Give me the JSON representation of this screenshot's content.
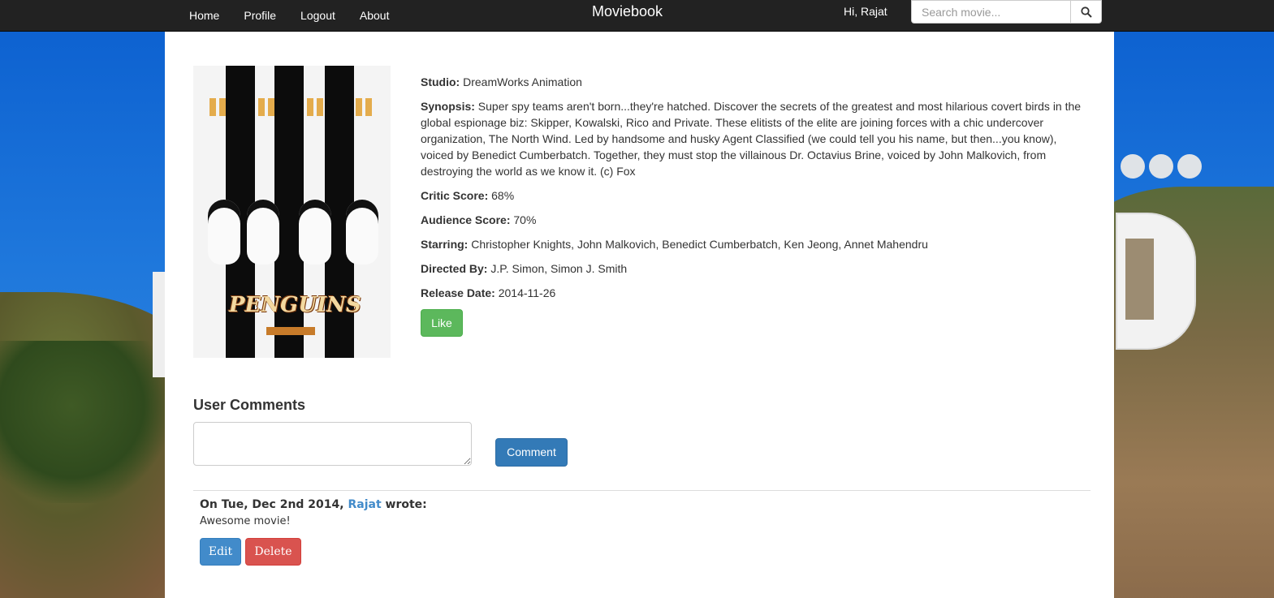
{
  "nav": {
    "links": [
      "Home",
      "Profile",
      "Logout",
      "About"
    ],
    "brand": "Moviebook",
    "greeting": "Hi, Rajat",
    "search_placeholder": "Search movie..."
  },
  "movie": {
    "poster_title": "PENGUINS",
    "studio_label": "Studio:",
    "studio": "DreamWorks Animation",
    "synopsis_label": "Synopsis:",
    "synopsis": "Super spy teams aren't born...they're hatched. Discover the secrets of the greatest and most hilarious covert birds in the global espionage biz: Skipper, Kowalski, Rico and Private. These elitists of the elite are joining forces with a chic undercover organization, The North Wind. Led by handsome and husky Agent Classified (we could tell you his name, but then...you know), voiced by Benedict Cumberbatch. Together, they must stop the villainous Dr. Octavius Brine, voiced by John Malkovich, from destroying the world as we know it. (c) Fox",
    "critic_label": "Critic Score:",
    "critic_score": "68%",
    "audience_label": "Audience Score:",
    "audience_score": "70%",
    "starring_label": "Starring:",
    "starring": "Christopher Knights, John Malkovich, Benedict Cumberbatch, Ken Jeong, Annet Mahendru",
    "directed_label": "Directed By:",
    "directed": "J.P. Simon, Simon J. Smith",
    "release_label": "Release Date:",
    "release_date": "2014-11-26",
    "like_label": "Like"
  },
  "comments": {
    "heading": "User Comments",
    "comment_button": "Comment",
    "items": [
      {
        "prefix": "On Tue, Dec 2nd 2014,",
        "author": "Rajat",
        "suffix": "wrote:",
        "text": "Awesome movie!",
        "edit_label": "Edit",
        "delete_label": "Delete"
      }
    ]
  },
  "colors": {
    "navbar": "#222222",
    "like": "#5cb85c",
    "comment": "#337ab7",
    "edit": "#428bca",
    "delete": "#d9534f"
  }
}
